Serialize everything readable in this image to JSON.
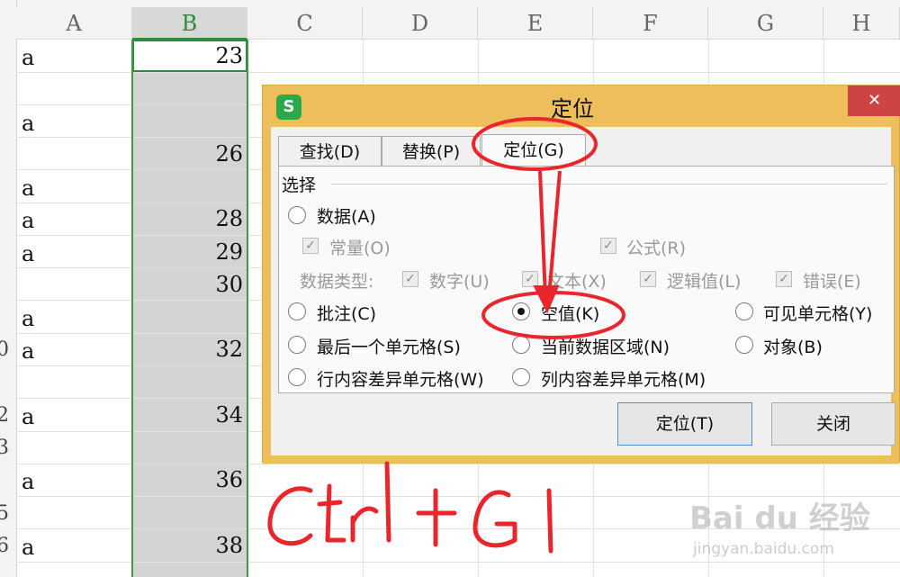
{
  "spreadsheet": {
    "columns": [
      "A",
      "B",
      "C",
      "D",
      "E",
      "F",
      "G",
      "H"
    ],
    "selected_column": "B",
    "row_header_fragments": [
      "0",
      "2",
      "3",
      "5",
      "6"
    ],
    "rows": [
      {
        "a": "a",
        "b": "23"
      },
      {
        "a": "",
        "b": ""
      },
      {
        "a": "a",
        "b": ""
      },
      {
        "a": "",
        "b": "26"
      },
      {
        "a": "a",
        "b": ""
      },
      {
        "a": "a",
        "b": "28"
      },
      {
        "a": "a",
        "b": "29"
      },
      {
        "a": "",
        "b": "30"
      },
      {
        "a": "a",
        "b": ""
      },
      {
        "a": "a",
        "b": "32"
      },
      {
        "a": "",
        "b": ""
      },
      {
        "a": "a",
        "b": "34"
      },
      {
        "a": "",
        "b": ""
      },
      {
        "a": "a",
        "b": "36"
      },
      {
        "a": "",
        "b": ""
      },
      {
        "a": "a",
        "b": "38"
      }
    ]
  },
  "dialog": {
    "title": "定位",
    "app_icon_label": "S",
    "close_glyph": "✕",
    "tabs": [
      {
        "label": "查找(D)",
        "active": false
      },
      {
        "label": "替换(P)",
        "active": false
      },
      {
        "label": "定位(G)",
        "active": true
      }
    ],
    "group_label": "选择",
    "options": {
      "data": "数据(A)",
      "constant": "常量(O)",
      "formula": "公式(R)",
      "data_type_label": "数据类型:",
      "number": "数字(U)",
      "text": "文本(X)",
      "logical": "逻辑值(L)",
      "error": "错误(E)",
      "comment": "批注(C)",
      "blank": "空值(K)",
      "visible_cells": "可见单元格(Y)",
      "last_cell": "最后一个单元格(S)",
      "current_region": "当前数据区域(N)",
      "object": "对象(B)",
      "row_diff": "行内容差异单元格(W)",
      "col_diff": "列内容差异单元格(M)"
    },
    "selected_option": "blank",
    "buttons": {
      "locate": "定位(T)",
      "close": "关闭"
    }
  },
  "annotation": {
    "handwritten_text": "Ctrl+G",
    "color": "#e8262b"
  },
  "watermark": {
    "brand": "Bai du 经验",
    "url": "jingyan.baidu.com"
  },
  "colors": {
    "accent_green": "#2e8b3d",
    "dialog_frame": "#eebd5c",
    "close_red": "#cc4444"
  }
}
